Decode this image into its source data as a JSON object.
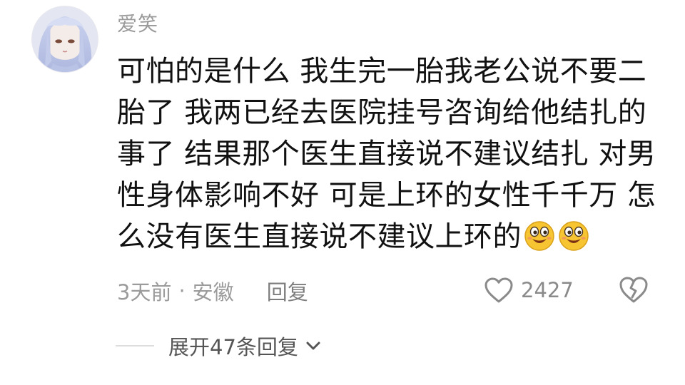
{
  "comment": {
    "username": "爱笑",
    "content_lines": [
      "可怕的是什么 我生完一胎我老公说不要二",
      "胎了 我两已经去医院挂号咨询给他结扎的",
      "事了 结果那个医生直接说不建议结扎 对男",
      "性身体影响不好 可是上环的女性千千万 怎",
      "么没有医生直接说不建议上环的"
    ],
    "trailing_emoji": [
      "grinning-emoji",
      "grinning-emoji"
    ],
    "time": "3天前",
    "separator": "·",
    "location": "安徽",
    "reply_label": "回复",
    "like_count": "2427",
    "expand_label": "展开47条回复"
  },
  "icons": {
    "like": "heart-outline-icon",
    "dislike": "broken-heart-icon",
    "expand": "chevron-down-icon"
  },
  "colors": {
    "username": "#9a9a9a",
    "content": "#111111",
    "meta": "#9b9b9b",
    "emoji_face": "#f7c531"
  }
}
